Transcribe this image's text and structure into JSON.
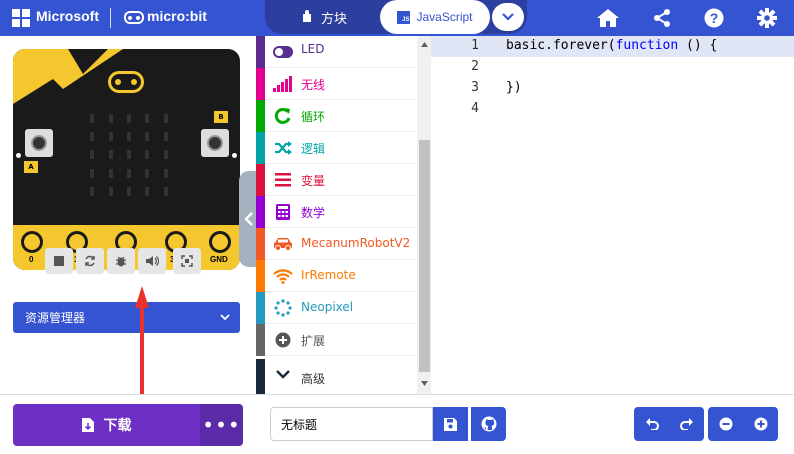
{
  "header": {
    "brand": "Microsoft",
    "product": "micro:bit",
    "mode_blocks": "方块",
    "mode_javascript": "JavaScript",
    "js_badge": "JS",
    "icons": [
      "home-icon",
      "share-icon",
      "help-icon",
      "settings-icon"
    ]
  },
  "simulator": {
    "button_a": "A",
    "button_b": "B",
    "pins": [
      "0",
      "1",
      "2",
      "3V",
      "GND"
    ],
    "controls": [
      "stop-icon",
      "restart-icon",
      "debug-icon",
      "sound-icon",
      "fullscreen-icon"
    ]
  },
  "explorer": {
    "label": "资源管理器"
  },
  "toolbox": {
    "categories": [
      {
        "label": "LED",
        "color": "#5c2d91",
        "icon": "toggle-icon"
      },
      {
        "label": "无线",
        "color": "#e3008c",
        "icon": "signal-bars-icon"
      },
      {
        "label": "循环",
        "color": "#00aa00",
        "icon": "loop-arrow-icon"
      },
      {
        "label": "逻辑",
        "color": "#00a4a6",
        "icon": "shuffle-icon"
      },
      {
        "label": "变量",
        "color": "#dc143c",
        "icon": "list-lines-icon"
      },
      {
        "label": "数学",
        "color": "#9400d3",
        "icon": "calculator-icon"
      },
      {
        "label": "MecanumRobotV2",
        "color": "#f15a24",
        "icon": "car-icon"
      },
      {
        "label": "IrRemote",
        "color": "#ff7a00",
        "icon": "wifi-icon"
      },
      {
        "label": "Neopixel",
        "color": "#2699bf",
        "icon": "dotted-circle-icon"
      },
      {
        "label": "扩展",
        "color": "#666666",
        "icon": "plus-circle-icon"
      }
    ],
    "advanced": "高级"
  },
  "editor": {
    "lines": [
      {
        "num": "1",
        "text": "basic.forever(",
        "kw": "function",
        "rest": " () {"
      },
      {
        "num": "2",
        "text": "",
        "kw": "",
        "rest": ""
      },
      {
        "num": "3",
        "text": "})",
        "kw": "",
        "rest": ""
      },
      {
        "num": "4",
        "text": "",
        "kw": "",
        "rest": ""
      }
    ]
  },
  "footer": {
    "download": "下载",
    "more": "•••",
    "project_name": "无标题",
    "icons": [
      "save-icon",
      "github-icon",
      "undo-icon",
      "redo-icon",
      "zoom-out-icon",
      "zoom-in-icon"
    ]
  },
  "colors": {
    "primary": "#3454d1",
    "download": "#6d2fc4",
    "microbit_yellow": "#f3c72d"
  }
}
